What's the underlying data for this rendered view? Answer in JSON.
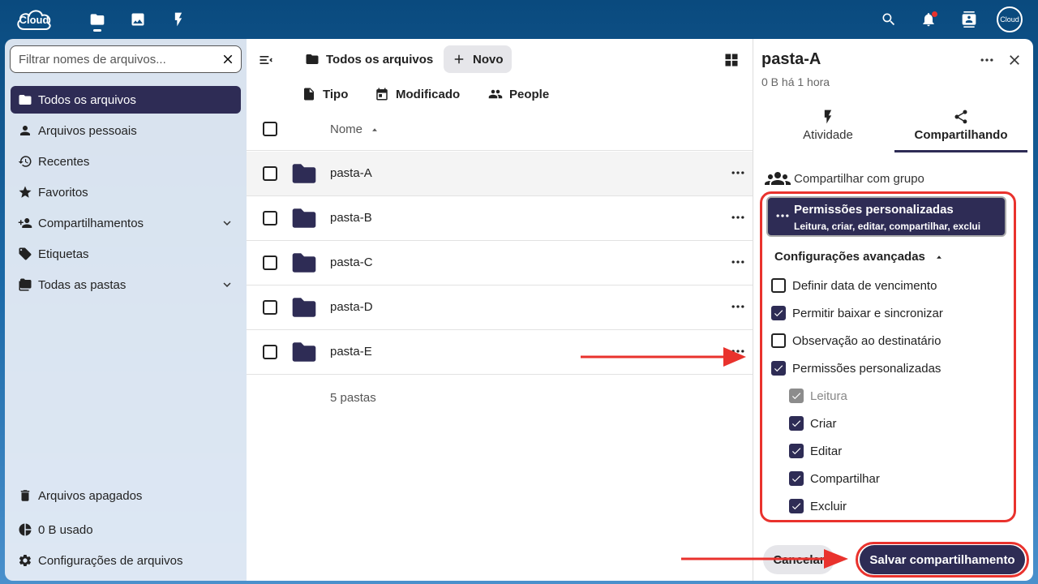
{
  "header": {
    "logo_text": "Cloud",
    "apps": [
      "files-icon",
      "photos-icon",
      "activity-icon"
    ],
    "avatar_text": "Cloud"
  },
  "nav": {
    "filter_placeholder": "Filtrar nomes de arquivos...",
    "items": [
      {
        "label": "Todos os arquivos",
        "icon": "folder-icon",
        "active": true
      },
      {
        "label": "Arquivos pessoais",
        "icon": "person-icon"
      },
      {
        "label": "Recentes",
        "icon": "history-icon"
      },
      {
        "label": "Favoritos",
        "icon": "star-icon"
      },
      {
        "label": "Compartilhamentos",
        "icon": "share-person-icon",
        "expandable": true
      },
      {
        "label": "Etiquetas",
        "icon": "tag-icon"
      },
      {
        "label": "Todas as pastas",
        "icon": "folders-icon",
        "expandable": true
      }
    ],
    "footer": [
      {
        "label": "Arquivos apagados",
        "icon": "trash-icon"
      },
      {
        "label": "0 B usado",
        "icon": "pie-chart-icon"
      },
      {
        "label": "Configurações de arquivos",
        "icon": "gear-icon"
      }
    ]
  },
  "main": {
    "breadcrumb": "Todos os arquivos",
    "new_label": "Novo",
    "filters": [
      "Tipo",
      "Modificado",
      "People"
    ],
    "column_name": "Nome",
    "rows": [
      "pasta-A",
      "pasta-B",
      "pasta-C",
      "pasta-D",
      "pasta-E"
    ],
    "summary": "5 pastas"
  },
  "panel": {
    "title": "pasta-A",
    "subtitle": "0 B há 1 hora",
    "tabs": [
      "Atividade",
      "Compartilhando"
    ],
    "active_tab": "Compartilhando",
    "share_with": "Compartilhar com grupo",
    "permission_title": "Permissões personalizadas",
    "permission_sub": "Leitura, criar, editar, compartilhar, exclui",
    "advanced_label": "Configurações avançadas",
    "options": [
      {
        "label": "Definir data de vencimento",
        "checked": false
      },
      {
        "label": "Permitir baixar e sincronizar",
        "checked": true
      },
      {
        "label": "Observação ao destinatário",
        "checked": false
      },
      {
        "label": "Permissões personalizadas",
        "checked": true
      }
    ],
    "sub_options": [
      {
        "label": "Leitura",
        "checked": true,
        "disabled": true
      },
      {
        "label": "Criar",
        "checked": true
      },
      {
        "label": "Editar",
        "checked": true
      },
      {
        "label": "Compartilhar",
        "checked": true
      },
      {
        "label": "Excluir",
        "checked": true
      }
    ],
    "cancel_label": "Cancelar",
    "save_label": "Salvar compartilhamento"
  },
  "colors": {
    "accent": "#2e2c55",
    "highlight_red": "#e9322d",
    "header_blue": "#0a4a7e"
  }
}
